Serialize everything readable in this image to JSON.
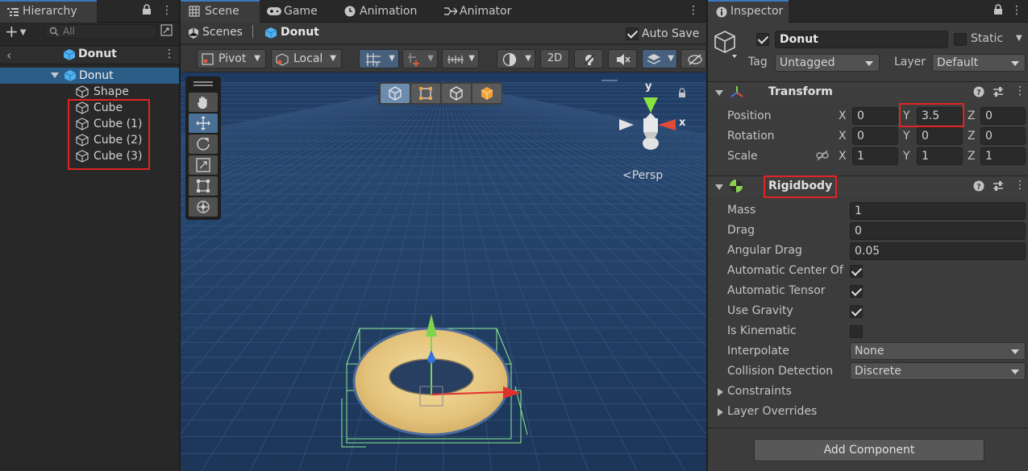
{
  "hierarchy": {
    "tab_label": "Hierarchy",
    "search_placeholder": "All",
    "scene_root": "Donut",
    "items": [
      {
        "label": "Donut"
      },
      {
        "label": "Shape"
      },
      {
        "label": "Cube"
      },
      {
        "label": "Cube (1)"
      },
      {
        "label": "Cube (2)"
      },
      {
        "label": "Cube (3)"
      }
    ]
  },
  "scene": {
    "tabs": [
      "Scene",
      "Game",
      "Animation",
      "Animator"
    ],
    "breadcrumb_root": "Scenes",
    "breadcrumb_current": "Donut",
    "auto_save_label": "Auto Save",
    "auto_save": true,
    "pivot_label": "Pivot",
    "space_label": "Local",
    "mode_2d": "2D",
    "gizmo_y": "y",
    "gizmo_x": "x",
    "persp_label": "<Persp"
  },
  "inspector": {
    "tab_label": "Inspector",
    "object_active": true,
    "object_name": "Donut",
    "static_label": "Static",
    "static": false,
    "tag_label": "Tag",
    "tag_value": "Untagged",
    "layer_label": "Layer",
    "layer_value": "Default",
    "transform": {
      "title": "Transform",
      "position_label": "Position",
      "rotation_label": "Rotation",
      "scale_label": "Scale",
      "axis_x": "X",
      "axis_y": "Y",
      "axis_z": "Z",
      "position": [
        "0",
        "3.5",
        "0"
      ],
      "rotation": [
        "0",
        "0",
        "0"
      ],
      "scale": [
        "1",
        "1",
        "1"
      ]
    },
    "rigidbody": {
      "title": "Rigidbody",
      "mass_label": "Mass",
      "mass": "1",
      "drag_label": "Drag",
      "drag": "0",
      "angular_drag_label": "Angular Drag",
      "angular_drag": "0.05",
      "auto_com_label": "Automatic Center Of",
      "auto_com": true,
      "auto_tensor_label": "Automatic Tensor",
      "auto_tensor": true,
      "use_gravity_label": "Use Gravity",
      "use_gravity": true,
      "is_kinematic_label": "Is Kinematic",
      "is_kinematic": false,
      "interpolate_label": "Interpolate",
      "interpolate": "None",
      "collision_label": "Collision Detection",
      "collision": "Discrete",
      "constraints_label": "Constraints",
      "layer_overrides_label": "Layer Overrides"
    },
    "add_component_label": "Add Component"
  },
  "colors": {
    "highlight_red": "#e02424",
    "selection_blue": "#2c5d87",
    "scene_sky": "#24406a",
    "donut": "#e8c77e",
    "collider_green": "#9cff9c"
  }
}
